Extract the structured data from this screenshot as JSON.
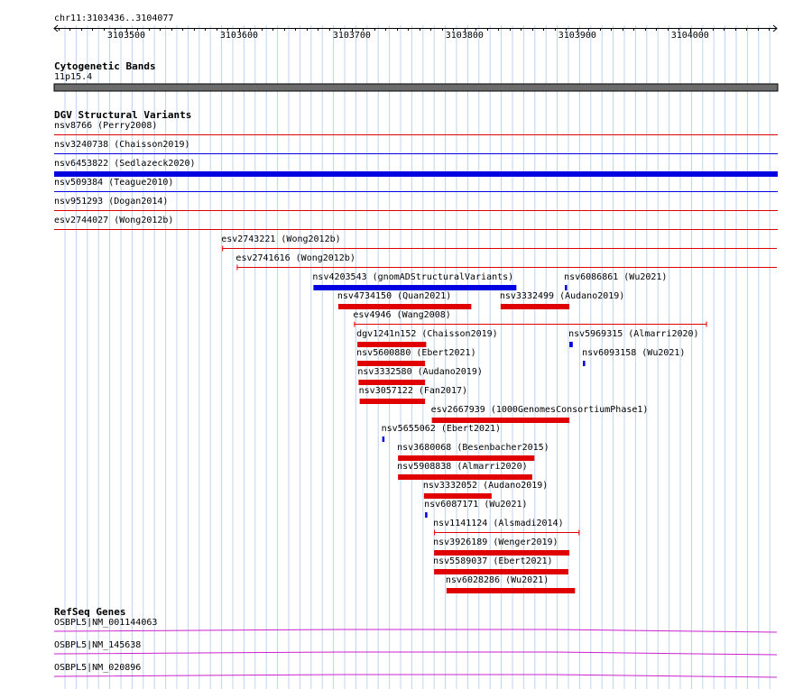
{
  "region": "chr11:3103436..3104077",
  "ruler": {
    "start": 3103436,
    "end": 3104077,
    "ticks": [
      "3103500",
      "3103600",
      "3103700",
      "3103800",
      "3103900",
      "3104000"
    ]
  },
  "tracks": {
    "cytoband": {
      "title": "Cytogenetic Bands",
      "band": "11p15.4",
      "color": "#6b6b6b"
    },
    "dgv": {
      "title": "DGV Structural Variants",
      "colors": {
        "loss": "#e00000",
        "gain": "#0000e0"
      },
      "full_span": [
        {
          "label": "nsv8766 (Perry2008)",
          "color": "red",
          "style": "line"
        },
        {
          "label": "nsv3240738 (Chaisson2019)",
          "color": "blue",
          "style": "line"
        },
        {
          "label": "nsv6453822 (Sedlazeck2020)",
          "color": "blue",
          "style": "bar"
        },
        {
          "label": "nsv509384 (Teague2010)",
          "color": "blue",
          "style": "line"
        },
        {
          "label": "nsv951293 (Dogan2014)",
          "color": "red",
          "style": "line"
        },
        {
          "label": "esv2744027 (Wong2012b)",
          "color": "red",
          "style": "line"
        }
      ],
      "features": [
        {
          "label": "esv2743221 (Wong2012b)",
          "start": 3103585,
          "end": 3104077,
          "color": "red",
          "style": "line"
        },
        {
          "label": "esv2741616 (Wong2012b)",
          "start": 3103598,
          "end": 3104077,
          "color": "red",
          "style": "line"
        },
        {
          "label": "nsv4203543 (gnomADStructuralVariants)",
          "start": 3103666,
          "end": 3103846,
          "color": "blue",
          "style": "bar"
        },
        {
          "label": "nsv6086861 (Wu2021)",
          "start": 3103889,
          "end": 3103891,
          "color": "blue",
          "style": "bar"
        },
        {
          "label": "nsv4734150 (Quan2021)",
          "start": 3103688,
          "end": 3103806,
          "color": "red",
          "style": "bar"
        },
        {
          "label": "nsv3332499 (Audano2019)",
          "start": 3103832,
          "end": 3103893,
          "color": "red",
          "style": "bar"
        },
        {
          "label": "esv4946 (Wang2008)",
          "start": 3103702,
          "end": 3104015,
          "color": "red",
          "style": "line"
        },
        {
          "label": "dgv1241n152 (Chaisson2019)",
          "start": 3103705,
          "end": 3103766,
          "color": "red",
          "style": "bar"
        },
        {
          "label": "nsv5969315 (Almarri2020)",
          "start": 3103893,
          "end": 3103896,
          "color": "blue",
          "style": "bar"
        },
        {
          "label": "nsv5600880 (Ebert2021)",
          "start": 3103705,
          "end": 3103765,
          "color": "red",
          "style": "bar"
        },
        {
          "label": "nsv6093158 (Wu2021)",
          "start": 3103905,
          "end": 3103907,
          "color": "blue",
          "style": "bar"
        },
        {
          "label": "nsv3332580 (Audano2019)",
          "start": 3103706,
          "end": 3103765,
          "color": "red",
          "style": "bar"
        },
        {
          "label": "nsv3057122 (Fan2017)",
          "start": 3103707,
          "end": 3103765,
          "color": "red",
          "style": "bar"
        },
        {
          "label": "esv2667939 (1000GenomesConsortiumPhase1)",
          "start": 3103771,
          "end": 3103893,
          "color": "red",
          "style": "bar"
        },
        {
          "label": "nsv5655062 (Ebert2021)",
          "start": 3103727,
          "end": 3103729,
          "color": "blue",
          "style": "bar"
        },
        {
          "label": "nsv3680068 (Besenbacher2015)",
          "start": 3103741,
          "end": 3103862,
          "color": "red",
          "style": "bar"
        },
        {
          "label": "nsv5908838 (Almarri2020)",
          "start": 3103741,
          "end": 3103860,
          "color": "red",
          "style": "bar"
        },
        {
          "label": "nsv3332052 (Audano2019)",
          "start": 3103764,
          "end": 3103824,
          "color": "red",
          "style": "bar"
        },
        {
          "label": "nsv6087171 (Wu2021)",
          "start": 3103765,
          "end": 3103767,
          "color": "blue",
          "style": "bar"
        },
        {
          "label": "nsv1141124 (Alsmadi2014)",
          "start": 3103773,
          "end": 3103902,
          "color": "red",
          "style": "line"
        },
        {
          "label": "nsv3926189 (Wenger2019)",
          "start": 3103773,
          "end": 3103893,
          "color": "red",
          "style": "bar"
        },
        {
          "label": "nsv5589037 (Ebert2021)",
          "start": 3103773,
          "end": 3103892,
          "color": "red",
          "style": "bar"
        },
        {
          "label": "nsv6028286 (Wu2021)",
          "start": 3103784,
          "end": 3103898,
          "color": "red",
          "style": "bar"
        }
      ]
    },
    "refseq": {
      "title": "RefSeq Genes",
      "color": "#cc22cc",
      "genes": [
        {
          "label": "OSBPL5|NM_001144063"
        },
        {
          "label": "OSBPL5|NM_145638"
        },
        {
          "label": "OSBPL5|NM_020896"
        }
      ]
    }
  },
  "colors": {
    "grid": "#bcd4ee",
    "axis": "#000000"
  }
}
